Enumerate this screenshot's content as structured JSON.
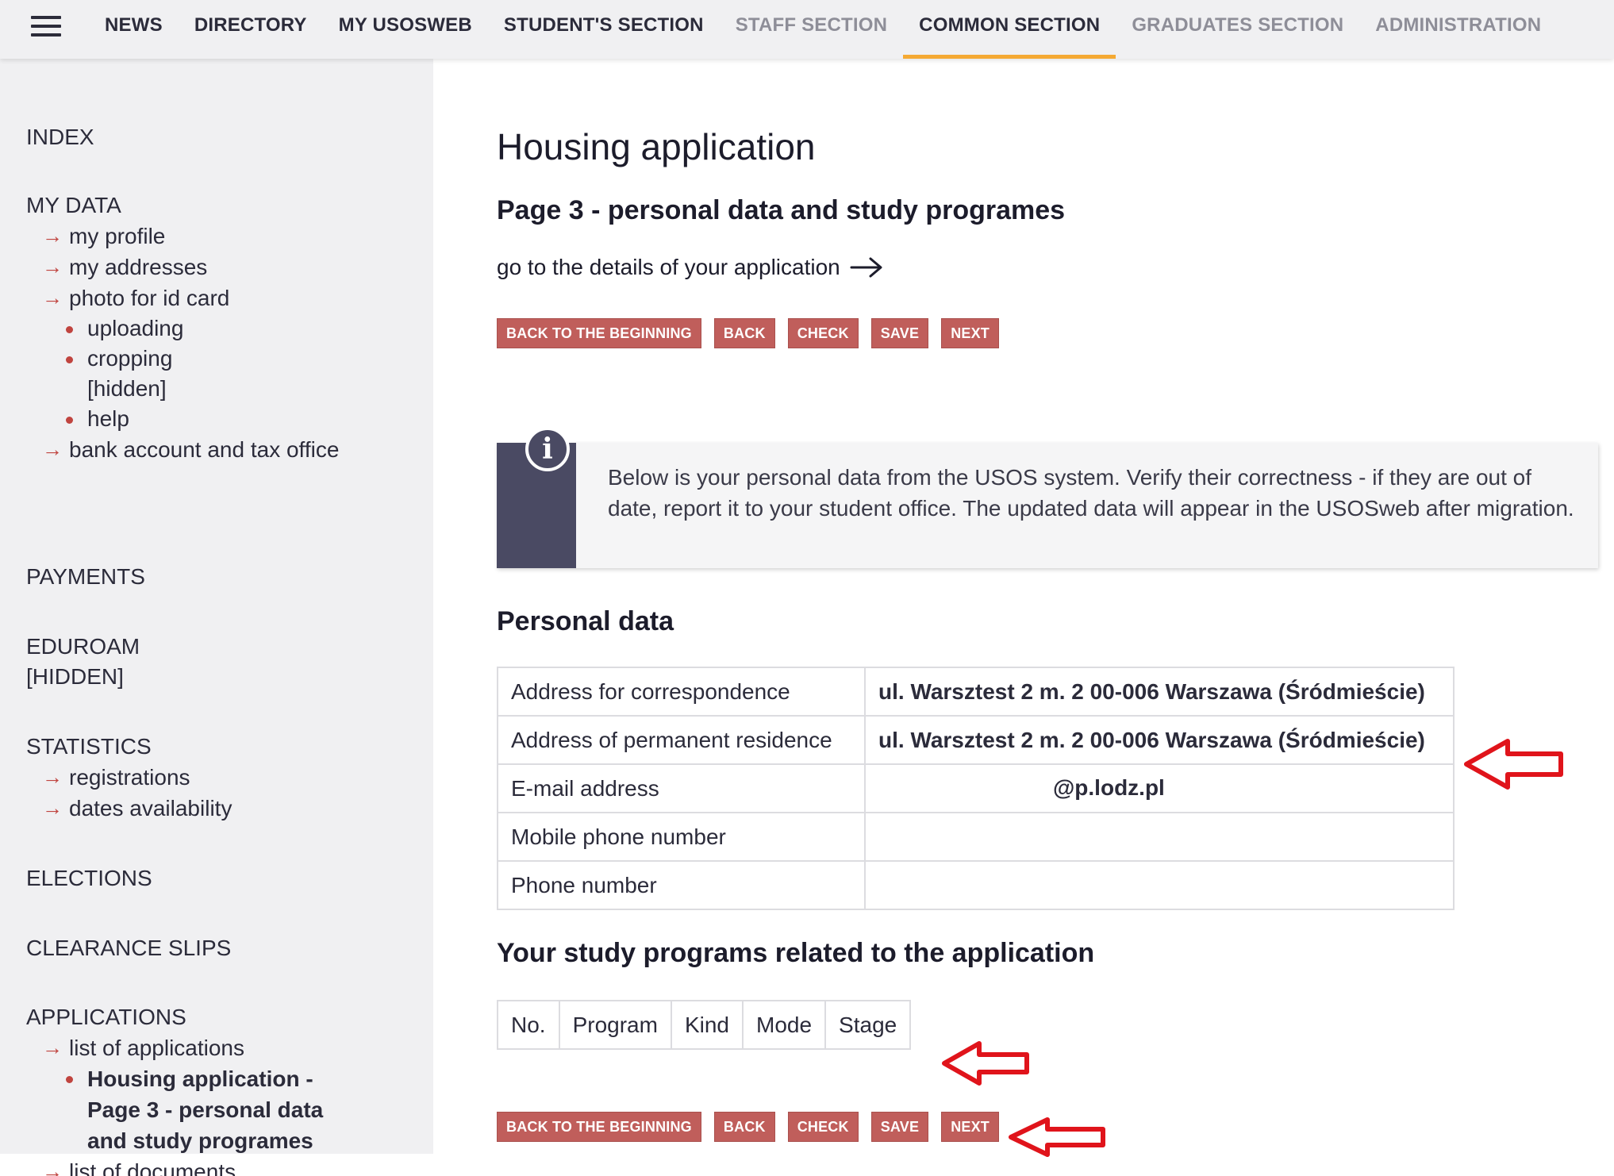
{
  "nav": {
    "items": [
      {
        "label": "NEWS"
      },
      {
        "label": "DIRECTORY"
      },
      {
        "label": "MY USOSWEB"
      },
      {
        "label": "STUDENT'S SECTION"
      },
      {
        "label": "STAFF SECTION"
      },
      {
        "label": "COMMON SECTION"
      },
      {
        "label": "GRADUATES SECTION"
      },
      {
        "label": "ADMINISTRATION"
      }
    ],
    "active": "COMMON SECTION",
    "accent_color": "#f5a933"
  },
  "sidebar": {
    "index": "INDEX",
    "my_data": {
      "title": "MY DATA",
      "links": [
        "my profile",
        "my addresses",
        "photo for id card"
      ],
      "photo_subitems": [
        "uploading",
        "cropping",
        "[hidden]",
        "help"
      ],
      "bank": "bank account and tax office"
    },
    "payments": "PAYMENTS",
    "eduroam": {
      "title": "EDUROAM",
      "hidden": "[HIDDEN]"
    },
    "statistics": {
      "title": "STATISTICS",
      "links": [
        "registrations",
        "dates availability"
      ]
    },
    "elections": "ELECTIONS",
    "clearance": "CLEARANCE SLIPS",
    "applications": {
      "title": "APPLICATIONS",
      "list_applications": "list of applications",
      "current": "Housing application - Page 3 - personal data and study programes",
      "list_documents": "list of documents"
    }
  },
  "main": {
    "title": "Housing application",
    "subtitle": "Page 3 - personal data and study programes",
    "details_link": "go to the details of your application",
    "buttons": {
      "back_to_beginning": "BACK TO THE BEGINNING",
      "back": "BACK",
      "check": "CHECK",
      "save": "SAVE",
      "next": "NEXT"
    },
    "button_color": "#c05e5b",
    "info_text": "Below is your personal data from the USOS system. Verify their correctness - if they are out of date, report it to your student office. The updated data will appear in the USOSweb after migration.",
    "personal_data": {
      "title": "Personal data",
      "rows": [
        {
          "label": "Address for correspondence",
          "value": "ul. Warsztest 2 m. 2 00-006 Warszawa (Śródmieście)"
        },
        {
          "label": "Address of permanent residence",
          "value": "ul. Warsztest 2 m. 2 00-006 Warszawa (Śródmieście)"
        },
        {
          "label": "E-mail address",
          "value": "@p.lodz.pl"
        },
        {
          "label": "Mobile phone number",
          "value": ""
        },
        {
          "label": "Phone number",
          "value": ""
        }
      ]
    },
    "study_programs": {
      "title": "Your study programs related to the application",
      "columns": [
        "No.",
        "Program",
        "Kind",
        "Mode",
        "Stage"
      ]
    }
  },
  "annotation_color": "#e0141b"
}
